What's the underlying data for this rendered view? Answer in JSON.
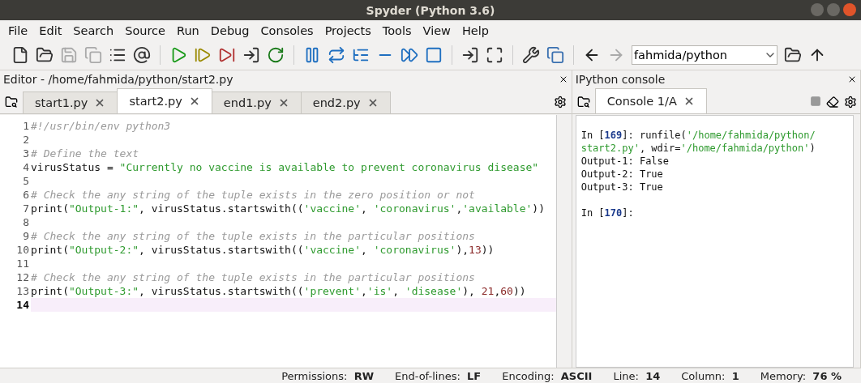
{
  "window": {
    "title": "Spyder (Python 3.6)"
  },
  "menu": [
    "File",
    "Edit",
    "Search",
    "Source",
    "Run",
    "Debug",
    "Consoles",
    "Projects",
    "Tools",
    "View",
    "Help"
  ],
  "toolbar": {
    "path_field": {
      "value": "fahmida/python"
    }
  },
  "editor": {
    "title": "Editor - /home/fahmida/python/start2.py",
    "tabs": [
      {
        "label": "start1.py",
        "selected": false
      },
      {
        "label": "start2.py",
        "selected": true
      },
      {
        "label": "end1.py",
        "selected": false
      },
      {
        "label": "end2.py",
        "selected": false
      }
    ],
    "lines": [
      {
        "number": "1",
        "current": false,
        "tokens": [
          {
            "kind": "comment",
            "text": "#!/usr/bin/env python3"
          }
        ]
      },
      {
        "number": "2",
        "current": false
      },
      {
        "number": "3",
        "current": false,
        "tokens": [
          {
            "kind": "comment",
            "text": "# Define the text"
          }
        ]
      },
      {
        "number": "4",
        "current": false,
        "tokens": [
          {
            "kind": "code",
            "text": "virusStatus = "
          },
          {
            "kind": "string",
            "text": "\"Currently no vaccine is available to prevent coronavirus disease\""
          }
        ]
      },
      {
        "number": "5",
        "current": false
      },
      {
        "number": "6",
        "current": false,
        "tokens": [
          {
            "kind": "comment",
            "text": "# Check the any string of the tuple exists in the zero position or not"
          }
        ]
      },
      {
        "number": "7",
        "current": false,
        "tokens": [
          {
            "kind": "code",
            "text": "print("
          },
          {
            "kind": "string",
            "text": "\"Output-1:\""
          },
          {
            "kind": "code",
            "text": ", virusStatus.startswith(("
          },
          {
            "kind": "string",
            "text": "'vaccine'"
          },
          {
            "kind": "code",
            "text": ", "
          },
          {
            "kind": "string",
            "text": "'coronavirus'"
          },
          {
            "kind": "code",
            "text": ","
          },
          {
            "kind": "string",
            "text": "'available'"
          },
          {
            "kind": "code",
            "text": "))"
          }
        ]
      },
      {
        "number": "8",
        "current": false
      },
      {
        "number": "9",
        "current": false,
        "tokens": [
          {
            "kind": "comment",
            "text": "# Check the any string of the tuple exists in the particular positions"
          }
        ]
      },
      {
        "number": "10",
        "current": false,
        "tokens": [
          {
            "kind": "code",
            "text": "print("
          },
          {
            "kind": "string",
            "text": "\"Output-2:\""
          },
          {
            "kind": "code",
            "text": ", virusStatus.startswith(("
          },
          {
            "kind": "string",
            "text": "'vaccine'"
          },
          {
            "kind": "code",
            "text": ", "
          },
          {
            "kind": "string",
            "text": "'coronavirus'"
          },
          {
            "kind": "code",
            "text": "),"
          },
          {
            "kind": "number",
            "text": "13"
          },
          {
            "kind": "code",
            "text": "))"
          }
        ]
      },
      {
        "number": "11",
        "current": false
      },
      {
        "number": "12",
        "current": false,
        "tokens": [
          {
            "kind": "comment",
            "text": "# Check the any string of the tuple exists in the particular positions"
          }
        ]
      },
      {
        "number": "13",
        "current": false,
        "tokens": [
          {
            "kind": "code",
            "text": "print("
          },
          {
            "kind": "string",
            "text": "\"Output-3:\""
          },
          {
            "kind": "code",
            "text": ", virusStatus.startswith(("
          },
          {
            "kind": "string",
            "text": "'prevent'"
          },
          {
            "kind": "code",
            "text": ","
          },
          {
            "kind": "string",
            "text": "'is'"
          },
          {
            "kind": "code",
            "text": ", "
          },
          {
            "kind": "string",
            "text": "'disease'"
          },
          {
            "kind": "code",
            "text": "), "
          },
          {
            "kind": "number",
            "text": "21"
          },
          {
            "kind": "code",
            "text": ","
          },
          {
            "kind": "number",
            "text": "60"
          },
          {
            "kind": "code",
            "text": "))"
          }
        ]
      },
      {
        "number": "14",
        "current": true
      }
    ]
  },
  "console": {
    "title": "IPython console",
    "tabs": [
      {
        "label": "Console 1/A",
        "selected": true
      }
    ],
    "lines": [
      {
        "kind": "blank"
      },
      {
        "tokens": [
          {
            "kind": "code",
            "text": "In ["
          },
          {
            "kind": "prompt",
            "text": "169"
          },
          {
            "kind": "code",
            "text": "]: runfile("
          },
          {
            "kind": "string",
            "text": "'/home/fahmida/python/"
          }
        ]
      },
      {
        "tokens": [
          {
            "kind": "string",
            "text": "start2.py'"
          },
          {
            "kind": "code",
            "text": ", wdir="
          },
          {
            "kind": "string",
            "text": "'/home/fahmida/python'"
          },
          {
            "kind": "code",
            "text": ")"
          }
        ]
      },
      {
        "tokens": [
          {
            "kind": "code",
            "text": "Output-1: False"
          }
        ]
      },
      {
        "tokens": [
          {
            "kind": "code",
            "text": "Output-2: True"
          }
        ]
      },
      {
        "tokens": [
          {
            "kind": "code",
            "text": "Output-3: True"
          }
        ]
      },
      {
        "kind": "blank"
      },
      {
        "tokens": [
          {
            "kind": "code",
            "text": "In ["
          },
          {
            "kind": "prompt",
            "text": "170"
          },
          {
            "kind": "code",
            "text": "]:"
          }
        ]
      }
    ]
  },
  "status_bar": [
    {
      "label": "Permissions:",
      "value": "RW"
    },
    {
      "label": "End-of-lines:",
      "value": "LF"
    },
    {
      "label": "Encoding:",
      "value": "ASCII"
    },
    {
      "label": "Line:",
      "value": "14"
    },
    {
      "label": "Column:",
      "value": "1"
    },
    {
      "label": "Memory:",
      "value": "76 %"
    }
  ]
}
